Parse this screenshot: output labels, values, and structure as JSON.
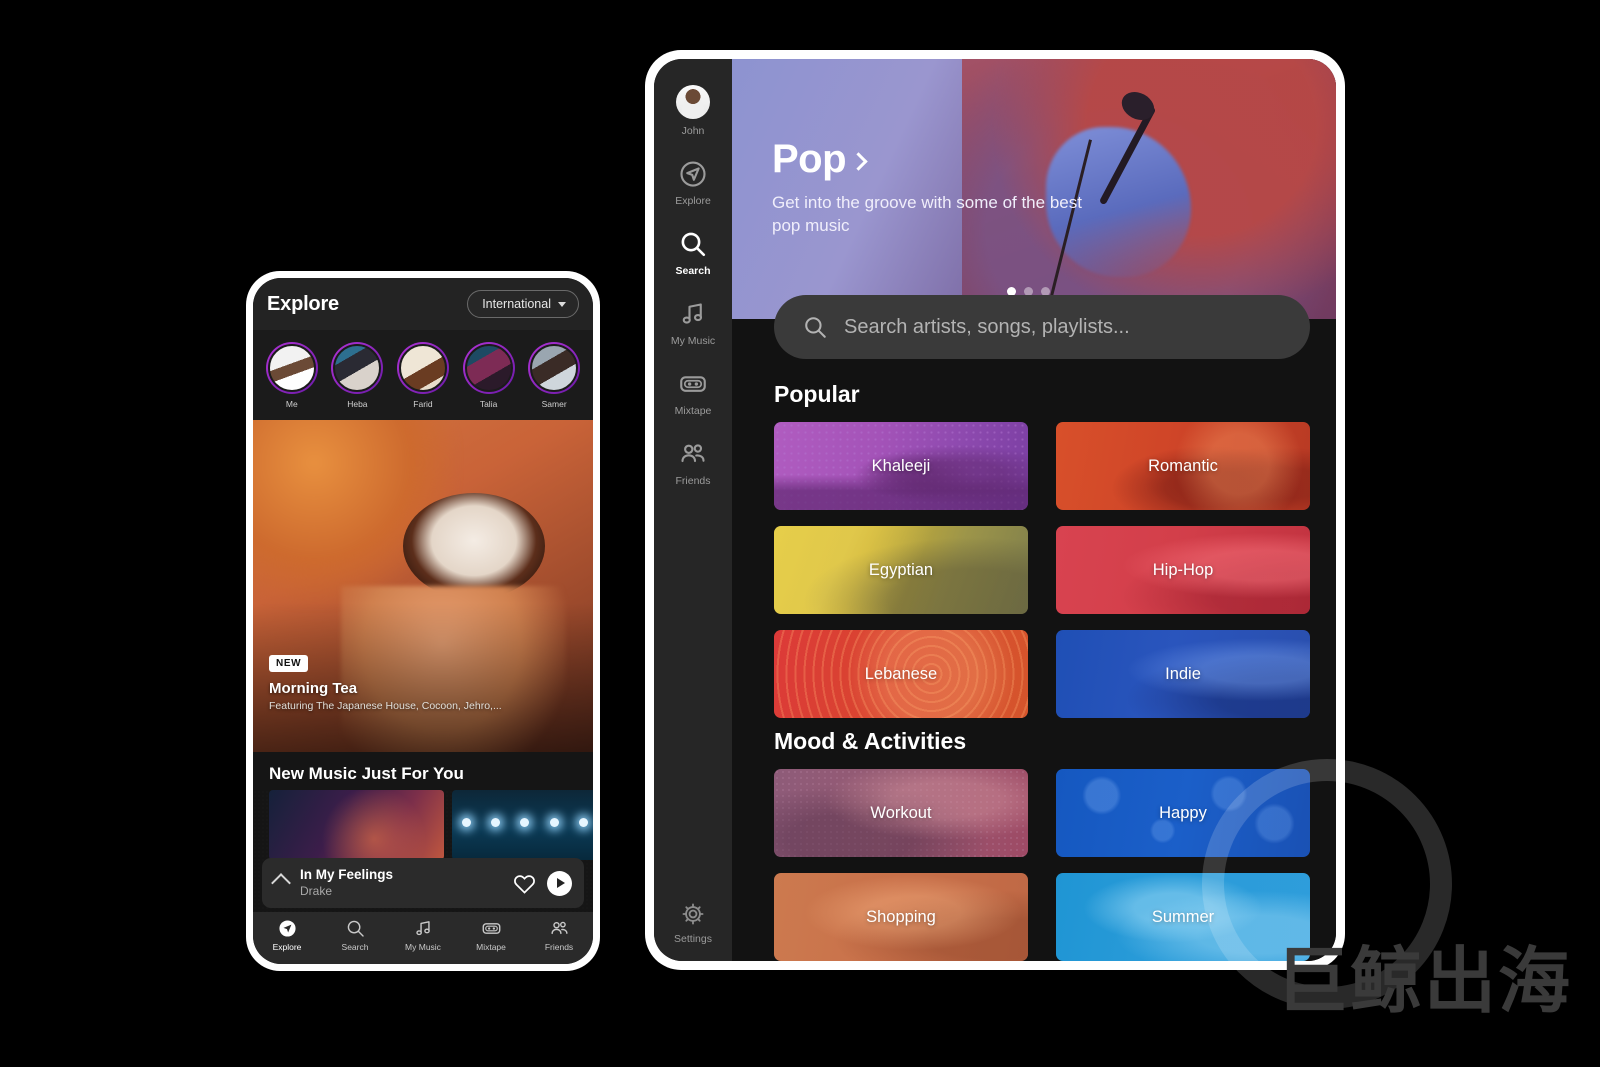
{
  "phone": {
    "header": {
      "title": "Explore",
      "region": "International"
    },
    "stories": [
      {
        "name": "Me"
      },
      {
        "name": "Heba"
      },
      {
        "name": "Farid"
      },
      {
        "name": "Talia"
      },
      {
        "name": "Samer"
      }
    ],
    "featured": {
      "badge": "NEW",
      "title": "Morning Tea",
      "subtitle": "Featuring The Japanese House, Cocoon, Jehro,..."
    },
    "section_title": "New Music Just For You",
    "player": {
      "title": "In My Feelings",
      "artist": "Drake",
      "like_icon": "heart-icon",
      "play_icon": "play-icon",
      "expand_icon": "chevron-up-icon"
    },
    "nav": [
      {
        "label": "Explore",
        "icon": "explore-icon",
        "active": true
      },
      {
        "label": "Search",
        "icon": "search-icon",
        "active": false
      },
      {
        "label": "My Music",
        "icon": "music-note-icon",
        "active": false
      },
      {
        "label": "Mixtape",
        "icon": "cassette-icon",
        "active": false
      },
      {
        "label": "Friends",
        "icon": "friends-icon",
        "active": false
      }
    ]
  },
  "tablet": {
    "sidebar": {
      "profile": {
        "label": "John",
        "icon": "avatar"
      },
      "items": [
        {
          "label": "Explore",
          "icon": "explore-icon",
          "active": false
        },
        {
          "label": "Search",
          "icon": "search-icon",
          "active": true
        },
        {
          "label": "My Music",
          "icon": "music-note-icon",
          "active": false
        },
        {
          "label": "Mixtape",
          "icon": "cassette-icon",
          "active": false
        },
        {
          "label": "Friends",
          "icon": "friends-icon",
          "active": false
        }
      ],
      "settings": {
        "label": "Settings",
        "icon": "gear-icon"
      }
    },
    "hero": {
      "title": "Pop",
      "chevron_icon": "chevron-right-icon",
      "subtitle": "Get into the groove with some of the best pop music",
      "dots": 3,
      "active_dot": 0
    },
    "search": {
      "placeholder": "Search artists, songs, playlists...",
      "icon": "search-icon"
    },
    "sections": [
      {
        "title": "Popular",
        "tiles": [
          {
            "label": "Khaleeji",
            "cls": "t-khaleeji",
            "color": "#a453b8"
          },
          {
            "label": "Romantic",
            "cls": "t-romantic",
            "color": "#cf4528"
          },
          {
            "label": "Egyptian",
            "cls": "t-egyptian",
            "color": "#cdb233"
          },
          {
            "label": "Hip-Hop",
            "cls": "t-hiphop",
            "color": "#d33f4a"
          },
          {
            "label": "Lebanese",
            "cls": "t-lebanese",
            "color": "#d94430"
          },
          {
            "label": "Indie",
            "cls": "t-indie",
            "color": "#2a55bd"
          }
        ]
      },
      {
        "title": "Mood & Activities",
        "tiles": [
          {
            "label": "Workout",
            "cls": "t-workout",
            "color": "#955a72"
          },
          {
            "label": "Happy",
            "cls": "t-happy",
            "color": "#1b5fc9"
          },
          {
            "label": "Shopping",
            "cls": "t-shopping",
            "color": "#c9714a"
          },
          {
            "label": "Summer",
            "cls": "t-summer",
            "color": "#2b9cd9"
          }
        ]
      }
    ]
  },
  "watermark": {
    "text": "巨鲸出海"
  }
}
